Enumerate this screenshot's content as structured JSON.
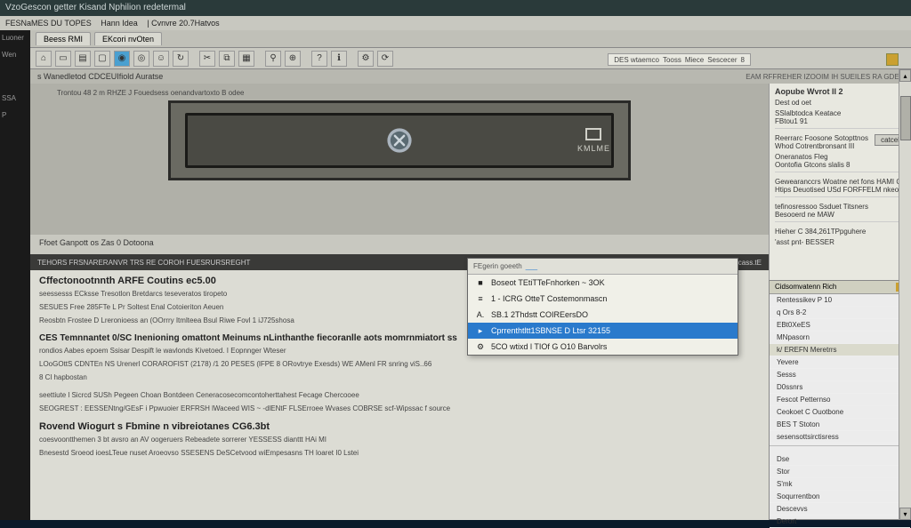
{
  "window": {
    "title": "VzoGescon getter Kisand Nphilion redetermal",
    "menu": [
      "FESNaMES DU TOPES",
      "Hann Idea",
      "Cvnvre 20.7Hatvos"
    ]
  },
  "left_strip": [
    "Luoner",
    "Wen",
    "SSA",
    "P"
  ],
  "tabs": [
    {
      "label": "Beess RMI"
    },
    {
      "label": "EKcori nvOten"
    }
  ],
  "toolbar_icons": [
    "home",
    "doc",
    "book",
    "page",
    "disk",
    "disk2",
    "user",
    "refresh",
    "",
    "cut",
    "copy",
    "paste",
    "",
    "find",
    "zoom",
    "",
    "help",
    "help2",
    "",
    "gear",
    "refresh2"
  ],
  "crumb": {
    "left": "s Wanedletod CDCEUIfiold Auratse",
    "mid": "Trontou 48 2 m RHZE J Fouedsess   oenandvartoxto B odee"
  },
  "mid_badge": [
    "DES wtaemco",
    "Tooss",
    "Miece",
    "Sescecer",
    "8"
  ],
  "header2": "EAM RFFREHER IZOOIM IH SUEILES RA GDES",
  "hero": {
    "label": "KMLME"
  },
  "sub_label": "Ffoet Ganpott os Zas 0 Dotoona",
  "dark_bar": {
    "left": "TEHORS FRSNARERANVR TRS RE COROH FUESRURSREGHT",
    "right": "ROE 9 tucass.tE"
  },
  "article": {
    "s1_title": "Cffectonootnnth ARFE Coutins ec5.00",
    "s1_p1": "seessesss ECksse Tresotlon Bretdarcs teseveratos tiropeto",
    "s1_p2": "SESUES Free 285FTe L Pr Soltest Enal Cotoieriton Aeuen",
    "s1_p3": "Reosbtn Frostee D Lreronioess an (OOrrry Itmlteea Bsul Riwe Fovl 1 iJ725shosa",
    "s2_title": "CES Temnnantet 0/SC Inenioning omattont Meinums nLinthanthe fiecoranlle aots momrnmiatort ss",
    "s2_p1": "rondios Aabes epoem Ssisar Despift le wavlonds Kivetoed. I Eopnnger Wteser",
    "s2_p2": "LOoGOttS CDNTEn NS Urenerl CORAROFIST (2178) /1 20 PESES (lFPE 8 ORovtrye Exesds) WE AMenl FR snring viS..66",
    "s2_p3": "8 Cl hapbostan",
    "s3_p1": "seettiute l Sicrcd SUSh Pegeen Choan Bontdeen         Ceneracosecomcontoherttahest Fecage Chercooee",
    "s3_p2": "SEOGREST : EESSENtng/GEsF i Ppwuoier  ERFRSH   lWaceed WIS ~ -dlENtF   FLSErroee   Wvases COBRSE scf-Wipssac f   source",
    "s4_title": "Rovend Wiogurt s Fbmine n vibreiotanes CG6.3bt",
    "s4_p1": "coesvoontthemen 3 bt avsro an              AV oogeruers Rebeadete    sorrerer YESSESS dianttt HAi MI",
    "s4_p2": "Bnesestd Sroeod ioesLTeue nuset Aroeovso   SSESENS  DeSCetvood wiEmpesasns TH loaret I0 Lstei"
  },
  "popup": {
    "header": "FEgerin goeeth",
    "items": [
      {
        "icon": "■",
        "label": "Boseot TEtiTTeFnhorken ~ 3OK",
        "sel": false
      },
      {
        "icon": "≡",
        "label": "1 - ICRG OtteT Costemonmascn",
        "sel": false
      },
      {
        "icon": "A.",
        "label": "SB.1 2Thdstt COIREersDO",
        "sel": false
      },
      {
        "icon": "▸",
        "label": "Cprrenthtltt1SBNSE D Ltsr 32155",
        "sel": true
      },
      {
        "icon": "⚙",
        "label": "5CO wtixd l TIOf G O10 Barvolrs",
        "sel": false
      }
    ]
  },
  "side": {
    "title": "Aopube Wvrot II 2",
    "sub": "Dest od oet",
    "group1_t": "SSlalbtodca Keatace",
    "group1_l": "FBtou1 91",
    "group2": "Reerrarc Foosone Sotopttnos Whod Cotrentbronsant III",
    "cancel": "catcel",
    "g3_t": "Oneranatos Fleg",
    "g3_l": "Oontofia Gtcons slalis 8",
    "g4": "Gewearanccrs Woatne net fons HAMI Cif Htips Deuotised USd FORFFELM nkeo",
    "g5_t": "tefinosressoo Ssduet Titsners",
    "g5_l": "Besooerd ne MAW",
    "g6": "Hieher C 384,261TPpguhere",
    "g7": "'asst pnt- BESSER"
  },
  "rlist": {
    "header": "Cidsomvatenn Rich",
    "top": [
      "Rentessikev P 10",
      "q Ors 8-2",
      "EBt0XeES",
      "MNpasorn"
    ],
    "hl": "k/ EREFN Meretrrs",
    "mid": [
      "Yevere",
      "Sesss",
      "D0ssnrs",
      "Fescot Petternso",
      "Ceokoet C Ouotbone",
      "BES T Stoton",
      "sesensottsirctisress"
    ],
    "bot": [
      "Dse",
      "Stor",
      "S'mk",
      "Soqurrentbon",
      "Descevvs",
      "Derort"
    ]
  }
}
